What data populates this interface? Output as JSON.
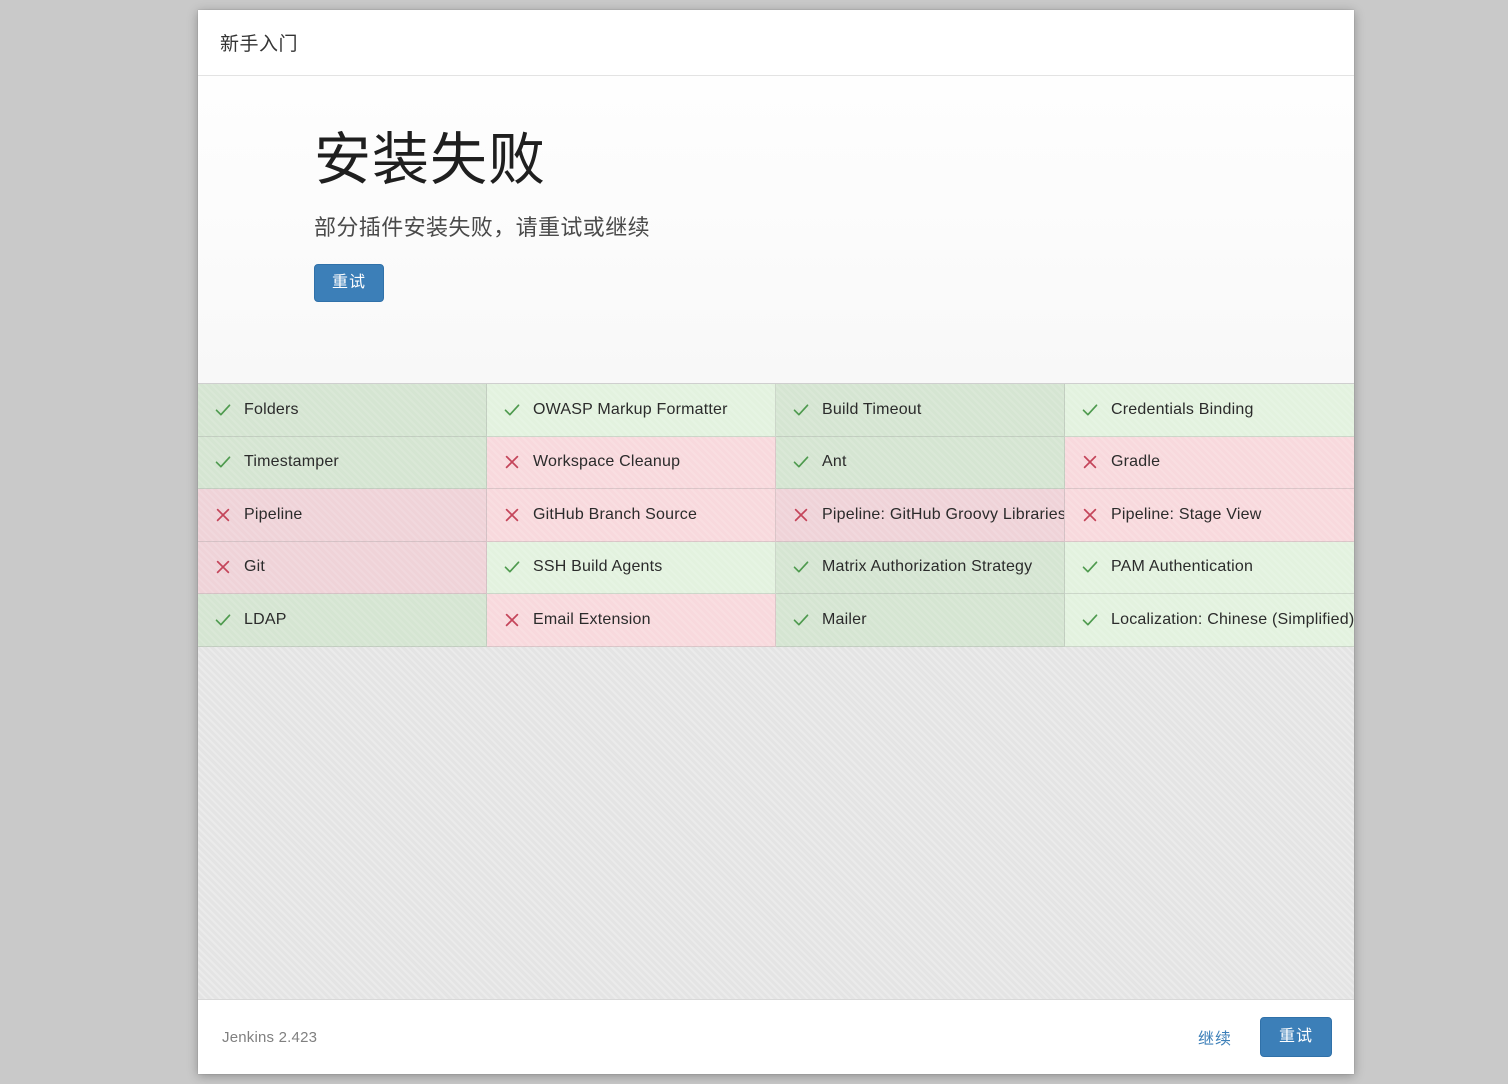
{
  "header": {
    "title": "新手入门"
  },
  "install_status": {
    "headline": "安装失败",
    "subhead": "部分插件安装失败，请重试或继续",
    "retry_label": "重试"
  },
  "colors": {
    "accent_blue": "#3c7fb8",
    "success_bg_dark": "#d5e5d2",
    "success_bg_light": "#e3f2df",
    "fail_bg_dark": "#efd3d8",
    "fail_bg_light": "#f8d9dd",
    "success_icon": "#4e9a4e",
    "fail_icon": "#c4455a",
    "page_bg": "#c9c9c9",
    "filler_bg": "#e4e4e4"
  },
  "plugin_grid": {
    "columns": 4,
    "rows": 5,
    "icons": {
      "success": "check-icon",
      "failure": "cross-icon"
    },
    "plugins": [
      {
        "name": "Folders",
        "status": "success"
      },
      {
        "name": "OWASP Markup Formatter",
        "status": "success"
      },
      {
        "name": "Build Timeout",
        "status": "success"
      },
      {
        "name": "Credentials Binding",
        "status": "success"
      },
      {
        "name": "Timestamper",
        "status": "success"
      },
      {
        "name": "Workspace Cleanup",
        "status": "failure"
      },
      {
        "name": "Ant",
        "status": "success"
      },
      {
        "name": "Gradle",
        "status": "failure"
      },
      {
        "name": "Pipeline",
        "status": "failure"
      },
      {
        "name": "GitHub Branch Source",
        "status": "failure"
      },
      {
        "name": "Pipeline: GitHub Groovy Libraries",
        "status": "failure"
      },
      {
        "name": "Pipeline: Stage View",
        "status": "failure"
      },
      {
        "name": "Git",
        "status": "failure"
      },
      {
        "name": "SSH Build Agents",
        "status": "success"
      },
      {
        "name": "Matrix Authorization Strategy",
        "status": "success"
      },
      {
        "name": "PAM Authentication",
        "status": "success"
      },
      {
        "name": "LDAP",
        "status": "success"
      },
      {
        "name": "Email Extension",
        "status": "failure"
      },
      {
        "name": "Mailer",
        "status": "success"
      },
      {
        "name": "Localization: Chinese (Simplified)",
        "status": "success"
      }
    ]
  },
  "footer": {
    "version": "Jenkins 2.423",
    "continue_label": "继续",
    "retry_label": "重试"
  }
}
